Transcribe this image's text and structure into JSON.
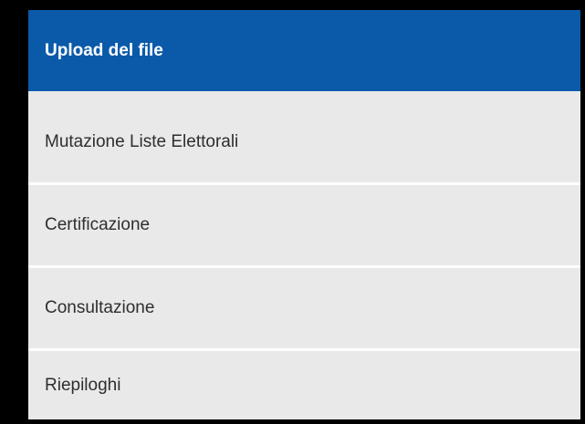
{
  "menu": {
    "items": [
      {
        "label": "Upload del file",
        "active": true
      },
      {
        "label": "Mutazione Liste Elettorali",
        "active": false
      },
      {
        "label": "Certificazione",
        "active": false
      },
      {
        "label": "Consultazione",
        "active": false
      },
      {
        "label": "Riepiloghi",
        "active": false
      }
    ]
  },
  "colors": {
    "active_background": "#0b5aaa",
    "active_text": "#ffffff",
    "item_background": "#e9e9e9",
    "item_text": "#2e2e2e",
    "separator": "#ffffff",
    "frame": "#000000"
  }
}
